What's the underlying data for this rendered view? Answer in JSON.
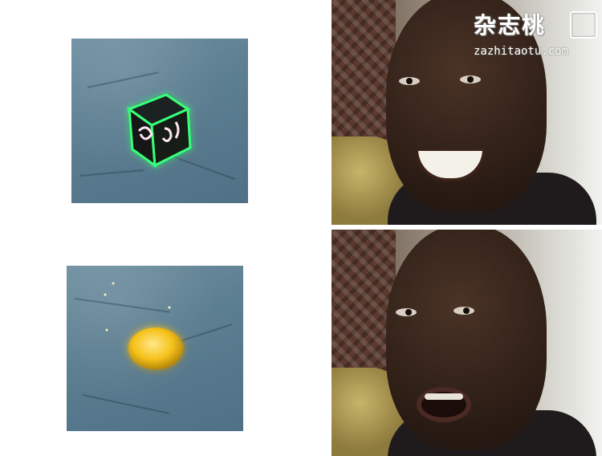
{
  "meme": {
    "top_left": {
      "item": "glowing-cube"
    },
    "bottom_left": {
      "item": "gold-coin"
    },
    "top_right": {
      "expression": "smiling"
    },
    "bottom_right": {
      "expression": "disappointed"
    }
  },
  "watermark": {
    "site_name": "杂志桃",
    "site_url": "zazhitaotu.com"
  },
  "colors": {
    "background": "#ffffff",
    "scene_blue": "#5d7f92",
    "cube_glow": "#39ff7a",
    "coin_gold": "#f5c21b"
  }
}
